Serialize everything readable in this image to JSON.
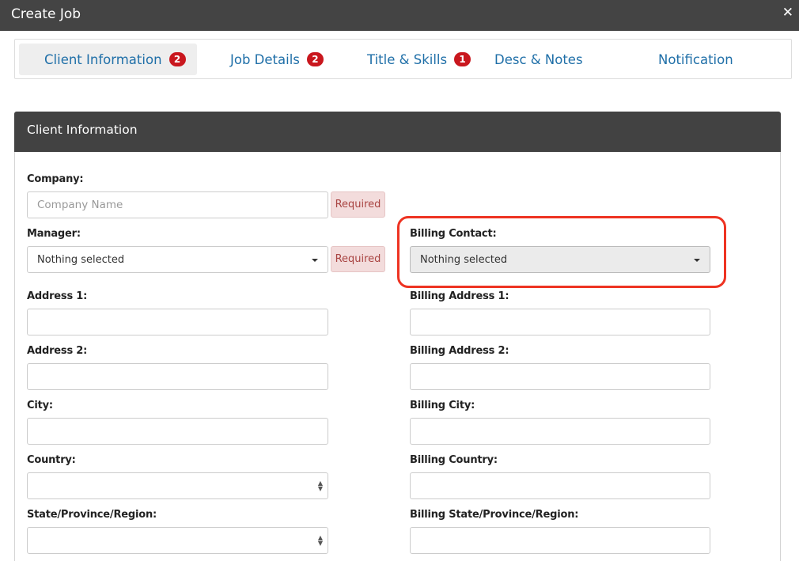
{
  "window": {
    "title": "Create Job",
    "close_glyph": "✕"
  },
  "tabs": [
    {
      "label": "Client Information",
      "badge": "2"
    },
    {
      "label": "Job Details",
      "badge": "2"
    },
    {
      "label": "Title & Skills",
      "badge": "1"
    },
    {
      "label": "Desc & Notes"
    },
    {
      "label": "Notification"
    }
  ],
  "panel": {
    "title": "Client Information"
  },
  "form": {
    "company": {
      "label": "Company:",
      "placeholder": "Company Name",
      "value": "",
      "required": "Required"
    },
    "manager": {
      "label": "Manager:",
      "selected": "Nothing selected",
      "required": "Required"
    },
    "billing_contact": {
      "label": "Billing Contact:",
      "selected": "Nothing selected"
    },
    "address1": {
      "label": "Address 1:",
      "value": ""
    },
    "address2": {
      "label": "Address 2:",
      "value": ""
    },
    "city": {
      "label": "City:",
      "value": ""
    },
    "country": {
      "label": "Country:",
      "selected": ""
    },
    "state": {
      "label": "State/Province/Region:",
      "selected": ""
    },
    "billing_address1": {
      "label": "Billing Address 1:",
      "value": ""
    },
    "billing_address2": {
      "label": "Billing Address 2:",
      "value": ""
    },
    "billing_city": {
      "label": "Billing City:",
      "value": ""
    },
    "billing_country": {
      "label": "Billing Country:",
      "value": ""
    },
    "billing_state": {
      "label": "Billing State/Province/Region:",
      "value": ""
    }
  },
  "colors": {
    "titlebar": "#444444",
    "panel_header": "#424242",
    "tab_text": "#1f6fa8",
    "badge": "#c9171e",
    "required_bg": "#f3dcdc",
    "required_text": "#a94442",
    "highlight": "#ee3322"
  },
  "icons": {
    "close": "close-icon",
    "dropdown": "caret-down-icon",
    "spinner": "up-down-arrows-icon"
  }
}
